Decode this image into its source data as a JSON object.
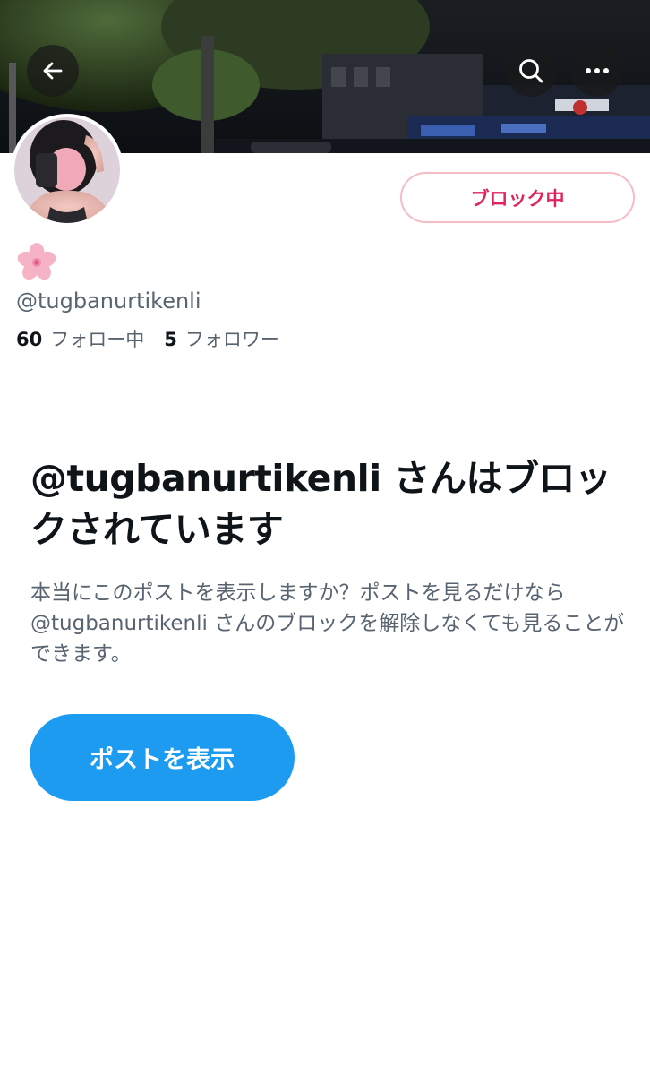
{
  "header": {
    "back_icon": "arrow-left-icon",
    "search_icon": "search-icon",
    "more_icon": "more-horizontal-icon"
  },
  "profile": {
    "display_name_emoji": "🌸",
    "handle": "@tugbanurtikenli",
    "following_count": "60",
    "following_label": "フォロー中",
    "followers_count": "5",
    "followers_label": "フォロワー",
    "block_button_label": "ブロック中"
  },
  "blocked_notice": {
    "title": "@tugbanurtikenli さんはブロックされています",
    "description": "本当にこのポストを表示しますか？ポストを見るだけなら @tugbanurtikenli さんのブロックを解除しなくても見ることができます。",
    "view_posts_button_label": "ポストを表示"
  },
  "colors": {
    "block_red": "#e0245e",
    "primary_blue": "#1d9bf0",
    "secondary_text": "#586470",
    "primary_text": "#0f1419"
  }
}
